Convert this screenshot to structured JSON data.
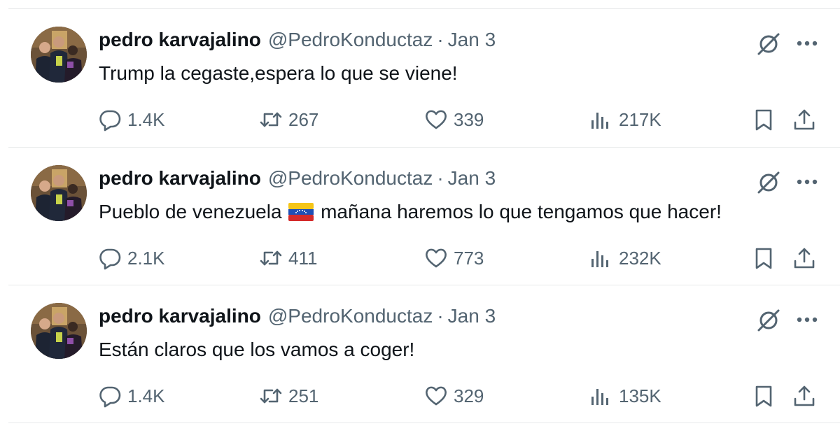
{
  "colors": {
    "text": "#0f1419",
    "secondary": "#536471",
    "divider": "#e7e9ea"
  },
  "tweets": [
    {
      "name": "pedro karvajalino",
      "handle": "@PedroKonductaz",
      "separator": "·",
      "date": "Jan 3",
      "text_before": "Trump la cegaste,espera lo que se viene!",
      "flag": "",
      "text_after": "",
      "replies": "1.4K",
      "retweets": "267",
      "likes": "339",
      "views": "217K"
    },
    {
      "name": "pedro karvajalino",
      "handle": "@PedroKonductaz",
      "separator": "·",
      "date": "Jan 3",
      "text_before": "Pueblo de venezuela",
      "flag": "venezuela-flag",
      "text_after": "mañana haremos lo que tengamos que hacer!",
      "replies": "2.1K",
      "retweets": "411",
      "likes": "773",
      "views": "232K"
    },
    {
      "name": "pedro karvajalino",
      "handle": "@PedroKonductaz",
      "separator": "·",
      "date": "Jan 3",
      "text_before": "Están claros que los vamos a coger!",
      "flag": "",
      "text_after": "",
      "replies": "1.4K",
      "retweets": "251",
      "likes": "329",
      "views": "135K"
    }
  ],
  "icons": {
    "grok": "grok-icon",
    "more": "more-dots-icon",
    "reply": "reply-bubble-icon",
    "retweet": "retweet-icon",
    "like": "heart-icon",
    "views": "views-bar-chart-icon",
    "bookmark": "bookmark-icon",
    "share": "share-upload-icon"
  }
}
